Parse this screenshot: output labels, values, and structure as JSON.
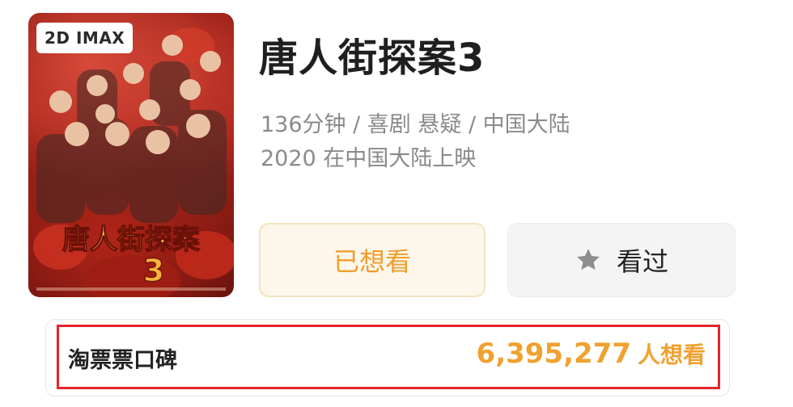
{
  "movie": {
    "format_badge": "2D IMAX",
    "title": "唐人街探案3",
    "meta_line_1": "136分钟 / 喜剧 悬疑 / 中国大陆",
    "meta_line_2": "2020 在中国大陆上映",
    "poster_title": "唐人街探案",
    "poster_number": "3"
  },
  "actions": {
    "want_label": "已想看",
    "seen_label": "看过",
    "seen_icon": "star-icon"
  },
  "rating": {
    "label": "淘票票口碑",
    "count": "6,395,277",
    "suffix": "人想看"
  },
  "colors": {
    "accent_orange": "#ef9e2d",
    "highlight_red": "#e4242b",
    "poster_red": "#a8241a"
  }
}
